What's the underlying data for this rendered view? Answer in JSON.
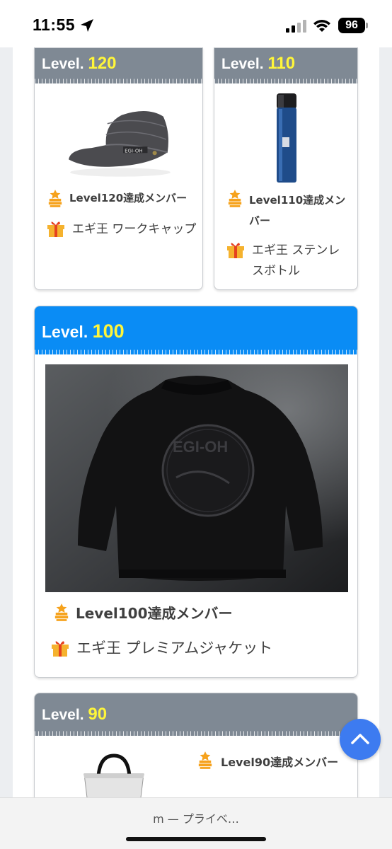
{
  "status_bar": {
    "time": "11:55",
    "battery": "96"
  },
  "cards": [
    {
      "level_prefix": "Level.",
      "level_num": "120",
      "achievement": "Level120達成メンバー",
      "reward": "エギ王 ワークキャップ",
      "image": "work-cap"
    },
    {
      "level_prefix": "Level.",
      "level_num": "110",
      "achievement": "Level110達成メンバー",
      "reward": "エギ王 ステンレスボトル",
      "image": "stainless-bottle"
    },
    {
      "level_prefix": "Level.",
      "level_num": "100",
      "achievement": "Level100達成メンバー",
      "reward": "エギ王 プレミアムジャケット",
      "image": "premium-jacket"
    },
    {
      "level_prefix": "Level.",
      "level_num": "90",
      "achievement": "Level90達成メンバー",
      "image": "tote-bag"
    }
  ],
  "browser_bar": {
    "url_text": "m — プライベ…"
  },
  "colors": {
    "header_gray": "#7f8994",
    "header_blue": "#0a8cf5",
    "level_yellow": "#fff63a",
    "fab_blue": "#3d7bf0"
  },
  "icons": [
    "location-arrow-icon",
    "signal-icon",
    "wifi-icon",
    "medal-icon",
    "gift-icon",
    "chevron-up-icon"
  ]
}
